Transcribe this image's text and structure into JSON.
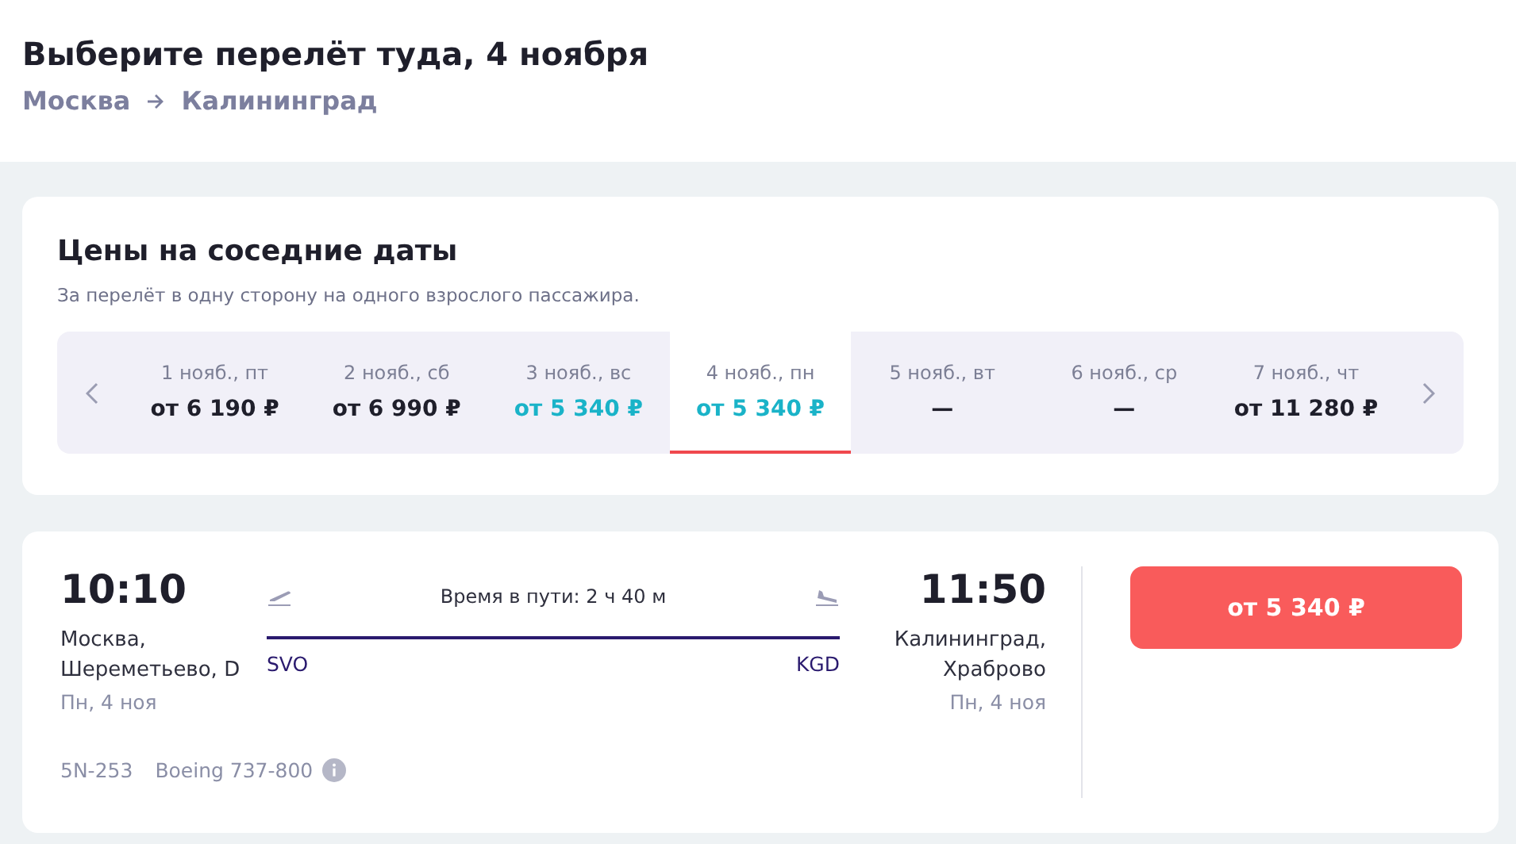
{
  "header": {
    "title": "Выберите перелёт туда, 4 ноября",
    "from": "Москва",
    "to": "Калининград"
  },
  "dates": {
    "title": "Цены на соседние даты",
    "subtitle": "За перелёт в одну сторону на одного взрослого пассажира.",
    "items": [
      {
        "date": "1 нояб., пт",
        "price": "от 6 190 ₽",
        "lowest": false,
        "selected": false
      },
      {
        "date": "2 нояб., сб",
        "price": "от 6 990 ₽",
        "lowest": false,
        "selected": false
      },
      {
        "date": "3 нояб., вс",
        "price": "от 5 340 ₽",
        "lowest": true,
        "selected": false
      },
      {
        "date": "4 нояб., пн",
        "price": "от 5 340 ₽",
        "lowest": true,
        "selected": true
      },
      {
        "date": "5 нояб., вт",
        "price": "—",
        "lowest": false,
        "selected": false
      },
      {
        "date": "6 нояб., ср",
        "price": "—",
        "lowest": false,
        "selected": false
      },
      {
        "date": "7 нояб., чт",
        "price": "от 11 280 ₽",
        "lowest": false,
        "selected": false
      }
    ]
  },
  "flight": {
    "departure": {
      "time": "10:10",
      "place": "Москва, Шереметьево, D",
      "date": "Пн, 4 ноя",
      "code": "SVO"
    },
    "arrival": {
      "time": "11:50",
      "place": "Калининград, Храброво",
      "date": "Пн, 4 ноя",
      "code": "KGD"
    },
    "duration": "Время в пути: 2 ч 40 м",
    "number": "5N-253",
    "aircraft": "Boeing 737-800",
    "button": "от 5 340 ₽"
  }
}
